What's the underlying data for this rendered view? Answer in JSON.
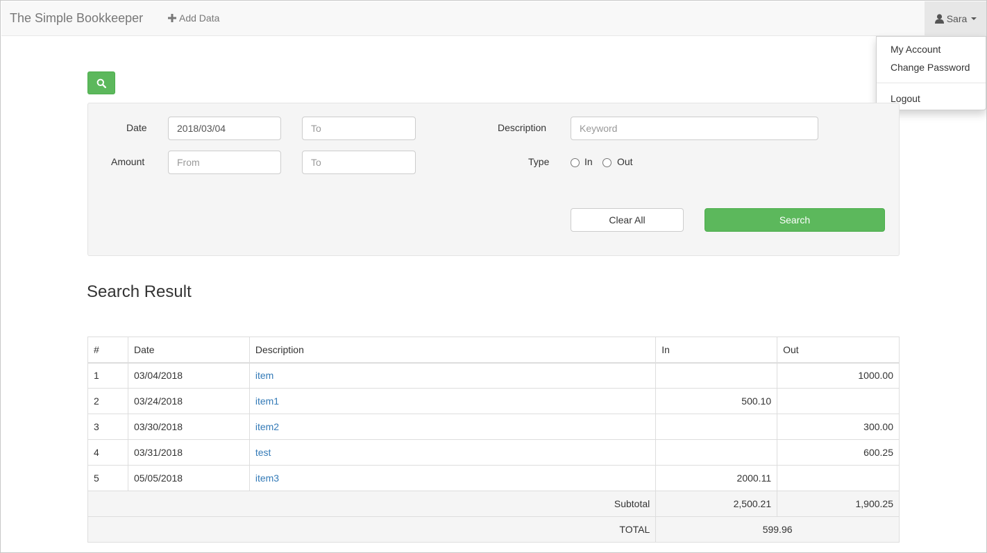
{
  "navbar": {
    "brand": "The Simple Bookkeeper",
    "add_data": "Add Data",
    "user": "Sara"
  },
  "user_menu": {
    "items": [
      "My Account",
      "Change Password"
    ],
    "logout": "Logout"
  },
  "search": {
    "date_label": "Date",
    "date_from_value": "2018/03/04",
    "date_to_placeholder": "To",
    "amount_label": "Amount",
    "amount_from_placeholder": "From",
    "amount_to_placeholder": "To",
    "description_label": "Description",
    "description_placeholder": "Keyword",
    "type_label": "Type",
    "type_in": "In",
    "type_out": "Out",
    "clear_label": "Clear All",
    "search_label": "Search"
  },
  "results": {
    "title": "Search Result",
    "columns": [
      "#",
      "Date",
      "Description",
      "In",
      "Out"
    ],
    "rows": [
      {
        "no": "1",
        "date": "03/04/2018",
        "description": "item",
        "in": "",
        "out": "1000.00"
      },
      {
        "no": "2",
        "date": "03/24/2018",
        "description": "item1",
        "in": "500.10",
        "out": ""
      },
      {
        "no": "3",
        "date": "03/30/2018",
        "description": "item2",
        "in": "",
        "out": "300.00"
      },
      {
        "no": "4",
        "date": "03/31/2018",
        "description": "test",
        "in": "",
        "out": "600.25"
      },
      {
        "no": "5",
        "date": "05/05/2018",
        "description": "item3",
        "in": "2000.11",
        "out": ""
      }
    ],
    "subtotal_label": "Subtotal",
    "subtotal_in": "2,500.21",
    "subtotal_out": "1,900.25",
    "total_label": "TOTAL",
    "total": "599.96"
  },
  "colors": {
    "primary_green": "#5cb85c",
    "link_blue": "#337ab7",
    "navbar_bg": "#f8f8f8"
  },
  "icons": {
    "add": "plus-icon",
    "user": "user-icon",
    "search_toggle": "search-icon"
  }
}
